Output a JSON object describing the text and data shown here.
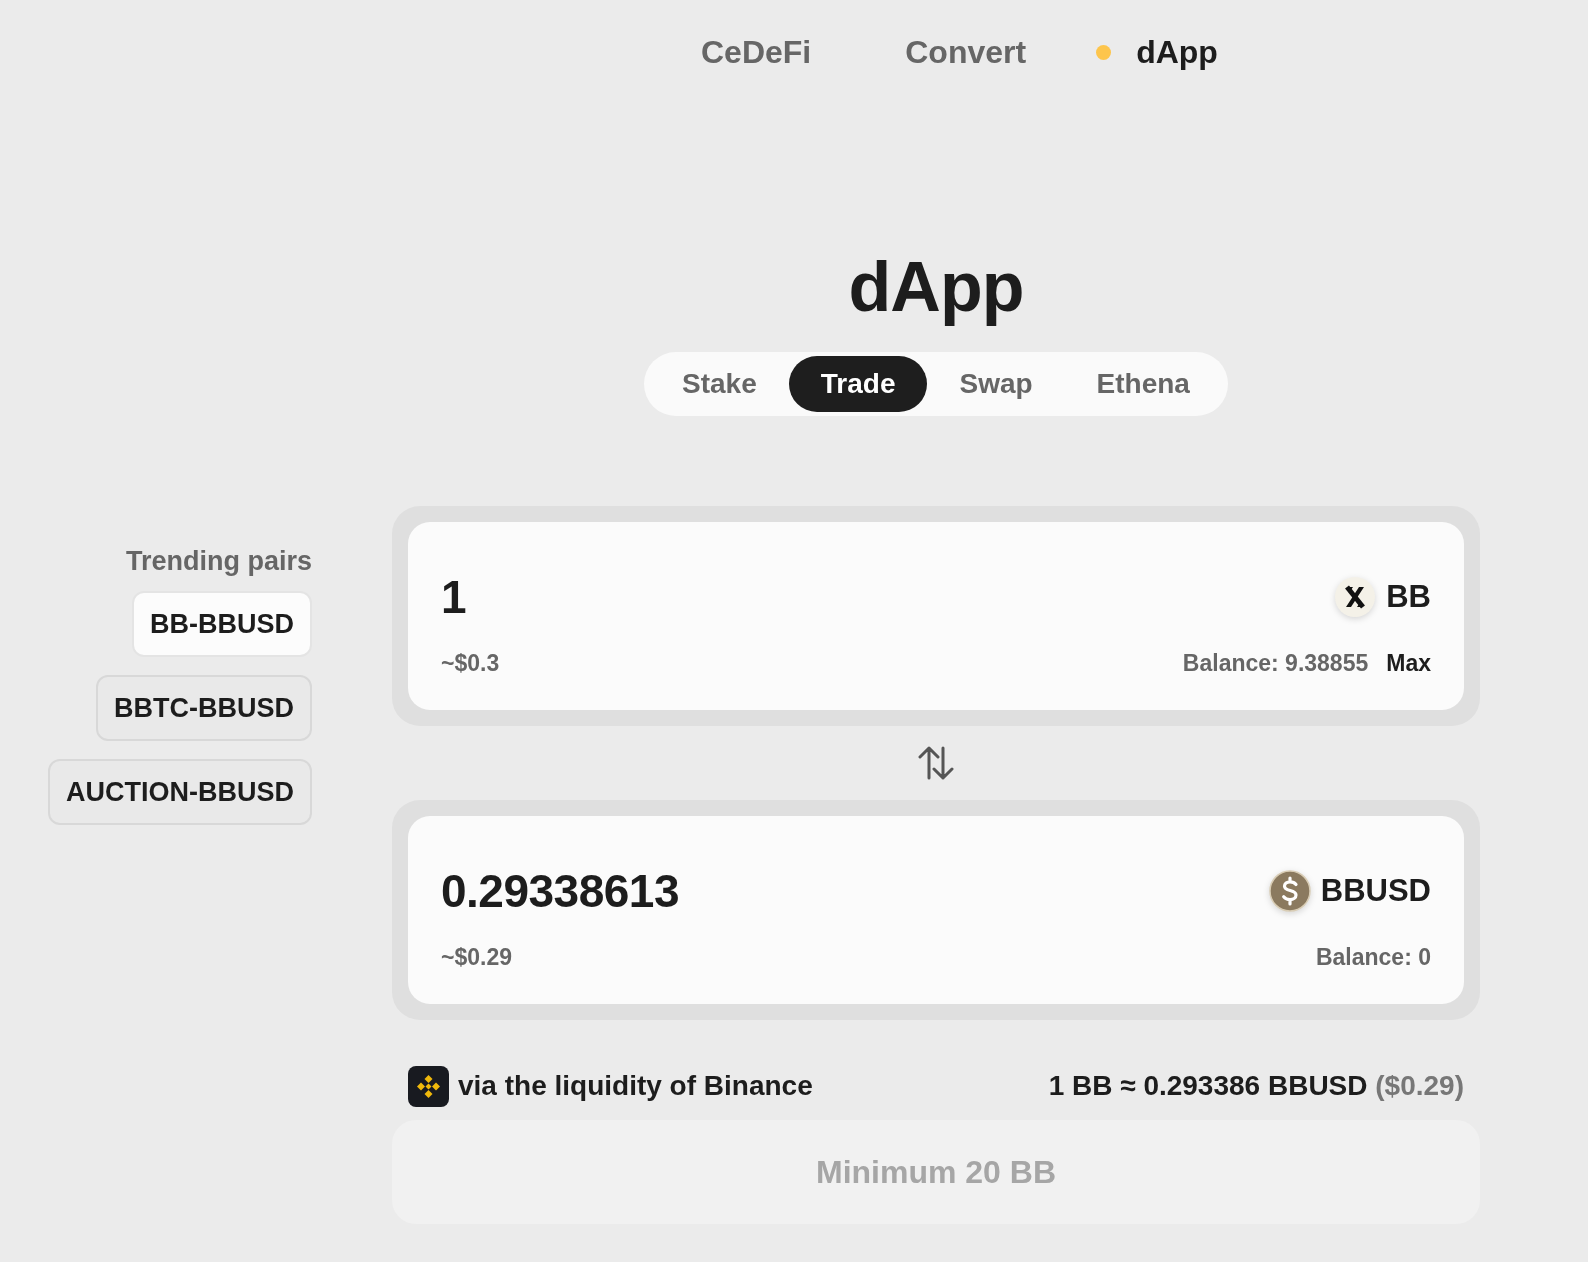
{
  "top_nav": [
    {
      "label": "CeDeFi",
      "selected": false
    },
    {
      "label": "Convert",
      "selected": false
    },
    {
      "label": "dApp",
      "selected": true
    }
  ],
  "title": "dApp",
  "tabs": [
    {
      "label": "Stake",
      "selected": false
    },
    {
      "label": "Trade",
      "selected": true
    },
    {
      "label": "Swap",
      "selected": false
    },
    {
      "label": "Ethena",
      "selected": false
    }
  ],
  "trending": {
    "title": "Trending pairs",
    "pairs": [
      {
        "label": "BB-BBUSD",
        "selected": true
      },
      {
        "label": "BBTC-BBUSD",
        "selected": false
      },
      {
        "label": "AUCTION-BBUSD",
        "selected": false
      }
    ]
  },
  "cards": [
    {
      "amount": "1",
      "usd": "~$0.3",
      "token": "BB",
      "balance": "Balance: 9.38855",
      "max": "Max"
    },
    {
      "amount": "0.29338613",
      "usd": "~$0.29",
      "token": "BBUSD",
      "balance": "Balance: 0"
    }
  ],
  "route": {
    "text": "via the liquidity of Binance",
    "rate": "1 BB ≈ 0.293386 BBUSD",
    "rate_usd": "($0.29)"
  },
  "submit": {
    "label": "Minimum 20 BB",
    "disabled": true
  }
}
